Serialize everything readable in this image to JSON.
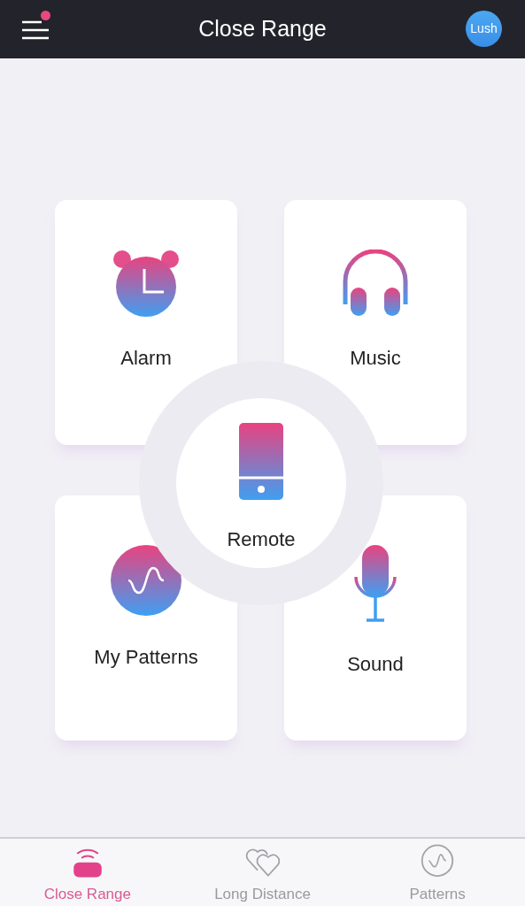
{
  "header": {
    "title": "Close Range",
    "notification": true,
    "device_badge": "Lush"
  },
  "tiles": [
    {
      "label": "Alarm",
      "kind": "alarm"
    },
    {
      "label": "Music",
      "kind": "music"
    },
    {
      "label": "My Patterns",
      "kind": "patterns"
    },
    {
      "label": "Sound",
      "kind": "sound"
    }
  ],
  "center": {
    "label": "Remote"
  },
  "tabs": [
    {
      "label": "Close Range",
      "kind": "close-range",
      "selected": true
    },
    {
      "label": "Long Distance",
      "kind": "long-distance",
      "selected": false
    },
    {
      "label": "Patterns",
      "kind": "patterns",
      "selected": false
    }
  ]
}
